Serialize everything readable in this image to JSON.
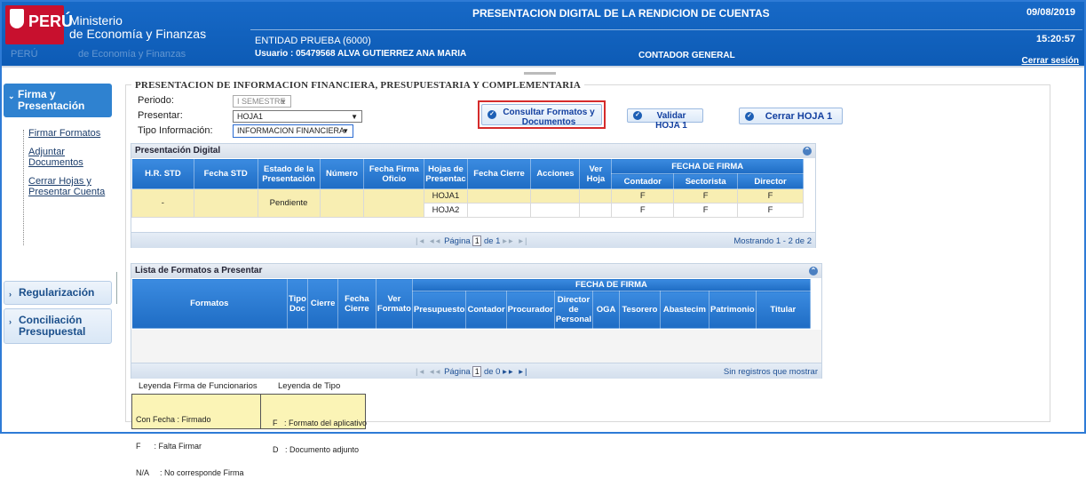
{
  "header": {
    "brand": "PERÚ",
    "ministry_line1": "Ministerio",
    "ministry_line2": "de Economía y Finanzas",
    "ministry_shadow": "de Economía y Finanzas",
    "title": "PRESENTACION DIGITAL DE LA RENDICION DE CUENTAS",
    "date": "09/08/2019",
    "time": "15:20:57",
    "entity": "ENTIDAD PRUEBA (6000)",
    "user": "Usuario : 05479568  ALVA GUTIERREZ ANA MARIA",
    "role": "CONTADOR GENERAL",
    "logout": "Cerrar sesión"
  },
  "sidebar": {
    "firma": "Firma y Presentación",
    "sub": [
      "Firmar Formatos",
      "Adjuntar Documentos",
      "Cerrar Hojas y Presentar Cuenta"
    ],
    "regularizacion": "Regularización",
    "conciliacion": "Conciliación Presupuestal"
  },
  "form": {
    "section_title": "PRESENTACION DE INFORMACION FINANCIERA, PRESUPUESTARIA Y COMPLEMENTARIA",
    "periodo_label": "Periodo:",
    "periodo_value": "I SEMESTRE",
    "presentar_label": "Presentar:",
    "presentar_value": "HOJA1",
    "tipo_label": "Tipo Información:",
    "tipo_value": "INFORMACION FINANCIERA",
    "btn_consultar": "Consultar Formatos y Documentos",
    "btn_validar": "Validar HOJA 1",
    "btn_cerrar": "Cerrar HOJA 1"
  },
  "panel1": {
    "title": "Presentación Digital",
    "columns": [
      "H.R. STD",
      "Fecha STD",
      "Estado de la Presentación",
      "Número",
      "Fecha Firma Oficio",
      "Hojas de Presentac",
      "Fecha Cierre",
      "Acciones",
      "Ver Hoja"
    ],
    "firma_group": "FECHA DE FIRMA",
    "firma_cols": [
      "Contador",
      "Sectorista",
      "Director"
    ],
    "row": {
      "hr": "-",
      "estado": "Pendiente",
      "hojas": [
        {
          "name": "HOJA1",
          "c": "F",
          "s": "F",
          "d": "F"
        },
        {
          "name": "HOJA2",
          "c": "F",
          "s": "F",
          "d": "F"
        }
      ]
    },
    "pager": {
      "label": "Página",
      "page": "1",
      "of": "de 1",
      "summary": "Mostrando 1 - 2 de 2"
    }
  },
  "panel2": {
    "title": "Lista de Formatos a Presentar",
    "columns": [
      "Formatos",
      "Tipo Doc",
      "Cierre",
      "Fecha Cierre",
      "Ver Formato"
    ],
    "firma_group": "FECHA DE FIRMA",
    "firma_cols": [
      "Presupuesto",
      "Contador",
      "Procurador",
      "Director de Personal",
      "OGA",
      "Tesorero",
      "Abastecim",
      "Patrimonio",
      "Titular"
    ],
    "pager": {
      "label": "Página",
      "page": "1",
      "of": "de 0",
      "summary": "Sin registros que mostrar"
    }
  },
  "legend": {
    "firma_title": "Leyenda Firma de Funcionarios",
    "tipo_title": "Leyenda de Tipo",
    "firma_lines": [
      "Con Fecha : Firmado",
      "F      : Falta Firmar",
      "N/A     : No corresponde Firma"
    ],
    "tipo_lines": [
      "F   : Formato del aplicativo",
      "D   : Documento adjunto"
    ]
  }
}
